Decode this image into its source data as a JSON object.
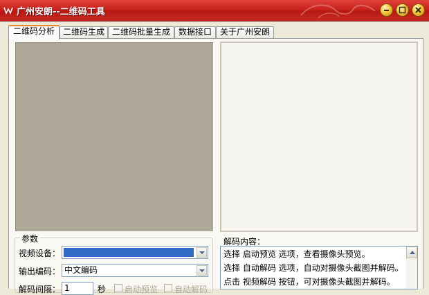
{
  "window": {
    "title": "广州安朗--二维码工具",
    "icon": "app-logo-icon",
    "colors": {
      "titlebar": "#c8231c",
      "button": "#f1c640"
    }
  },
  "titlebar_buttons": [
    {
      "name": "minimize-button",
      "icon": "minimize-icon"
    },
    {
      "name": "restore-button",
      "icon": "restore-icon"
    },
    {
      "name": "close-button",
      "icon": "close-icon"
    }
  ],
  "tabs": [
    {
      "label": "二维码分析",
      "active": true
    },
    {
      "label": "二维码生成"
    },
    {
      "label": "二维码批量生成"
    },
    {
      "label": "数据接口"
    },
    {
      "label": "关于广州安朗"
    }
  ],
  "params": {
    "legend": "参数",
    "video_device_label": "视频设备：",
    "video_device_value": "",
    "output_encoding_label": "输出编码：",
    "output_encoding_value": "中文编码",
    "interval_label": "解码间隔：",
    "interval_value": "1",
    "interval_unit": "秒",
    "auto_preview_label": "启动预览",
    "auto_decode_label": "自动解码"
  },
  "result": {
    "label": "解码内容：",
    "lines": [
      "选择 启动预览 选项，查看摄像头预览。",
      "选择 自动解码 选项，自动对摄像头截图并解码。",
      "点击 视频解码 按钮，可对摄像头截图并解码。"
    ]
  },
  "accent_color": "#316ac5"
}
